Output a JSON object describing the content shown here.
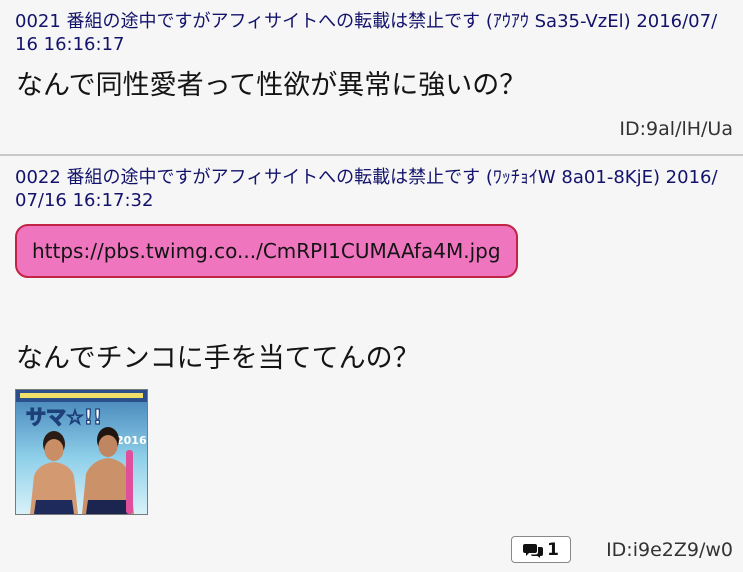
{
  "posts": [
    {
      "header": "0021 番組の途中ですがアフィサイトへの転載は禁止です (ｱｳｱｳ Sa35-VzEl) 2016/07/16 16:16:17",
      "body": "なんで同性愛者って性欲が異常に強いの？",
      "id": "ID:9al/lH/Ua"
    },
    {
      "header": "0022 番組の途中ですがアフィサイトへの転載は禁止です (ﾜｯﾁｮｲW 8a01-8KjE) 2016/07/16 16:17:32",
      "image_link": "https://pbs.twimg.co.../CmRPI1CUMAAfa4M.jpg",
      "body": "なんでチンコに手を当ててんの？",
      "thumbnail_icon": "magazine-cover-thumbnail",
      "thumbnail_cover_text": "サマ☆!!",
      "reply_count": "1",
      "reply_icon": "speech-bubbles-icon",
      "id": "ID:i9e2Z9/w0"
    }
  ],
  "colors": {
    "background": "#f6f6f6",
    "header_text": "#13136c",
    "link_fill": "#ef75bf",
    "link_border": "#c22445",
    "divider": "#c9c9c9"
  }
}
